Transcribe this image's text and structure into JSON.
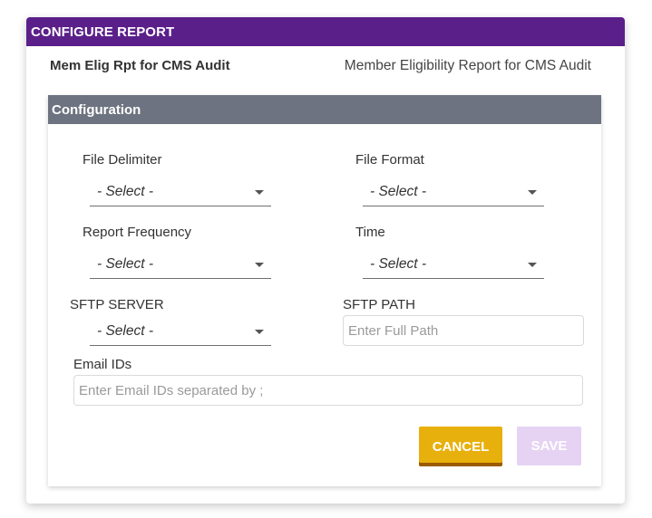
{
  "dialog": {
    "title": "CONFIGURE REPORT",
    "report_name": "Mem Elig Rpt for CMS Audit",
    "report_description": "Member Eligibility Report for CMS Audit"
  },
  "configuration": {
    "title": "Configuration",
    "file_delimiter": {
      "label": "File Delimiter",
      "value": "- Select -"
    },
    "file_format": {
      "label": "File Format",
      "value": "- Select -"
    },
    "report_frequency": {
      "label": "Report Frequency",
      "value": "- Select -"
    },
    "time": {
      "label": "Time",
      "value": "- Select -"
    },
    "sftp_server": {
      "label": "SFTP SERVER",
      "value": "- Select -"
    },
    "sftp_path": {
      "label": "SFTP PATH",
      "placeholder": "Enter Full Path",
      "value": ""
    },
    "email_ids": {
      "label": "Email IDs",
      "placeholder": "Enter Email IDs separated by ;",
      "value": ""
    }
  },
  "buttons": {
    "cancel": "CANCEL",
    "save": "SAVE"
  },
  "colors": {
    "header_purple": "#5b1f8a",
    "config_header_gray": "#6d7380",
    "cancel_yellow": "#e8b00d",
    "save_disabled": "#e6d3f4"
  }
}
